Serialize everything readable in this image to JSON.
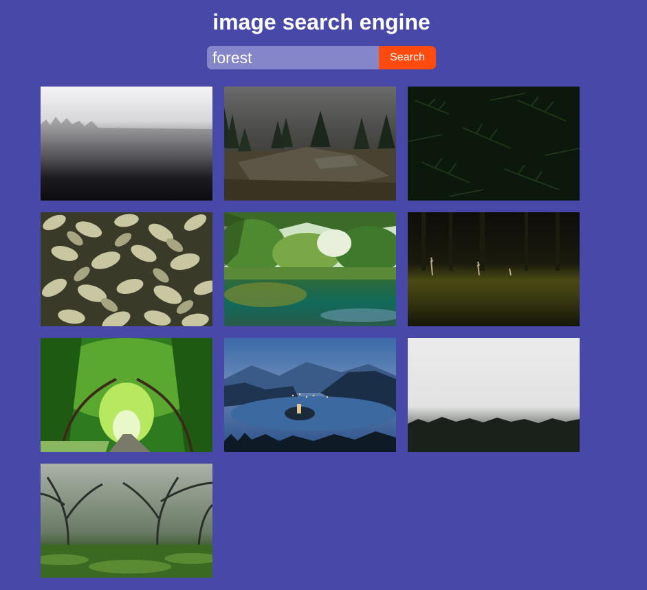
{
  "header": {
    "title": "image search engine"
  },
  "search": {
    "value": "forest",
    "button_label": "Search"
  },
  "colors": {
    "background": "#4848a8",
    "input_background": "#8585c9",
    "button_background": "#ff4a10",
    "text": "#ffffff"
  },
  "results": [
    {
      "image": "misty-forest-gradient"
    },
    {
      "image": "rocky-clearing-with-pines"
    },
    {
      "image": "dark-pine-branches"
    },
    {
      "image": "pale-ivy-leaves"
    },
    {
      "image": "green-lake-with-trees"
    },
    {
      "image": "dark-meadow-with-herons"
    },
    {
      "image": "green-tree-tunnel-path"
    },
    {
      "image": "lake-island-at-dusk"
    },
    {
      "image": "foggy-treeline"
    },
    {
      "image": "misty-bare-trees"
    }
  ]
}
